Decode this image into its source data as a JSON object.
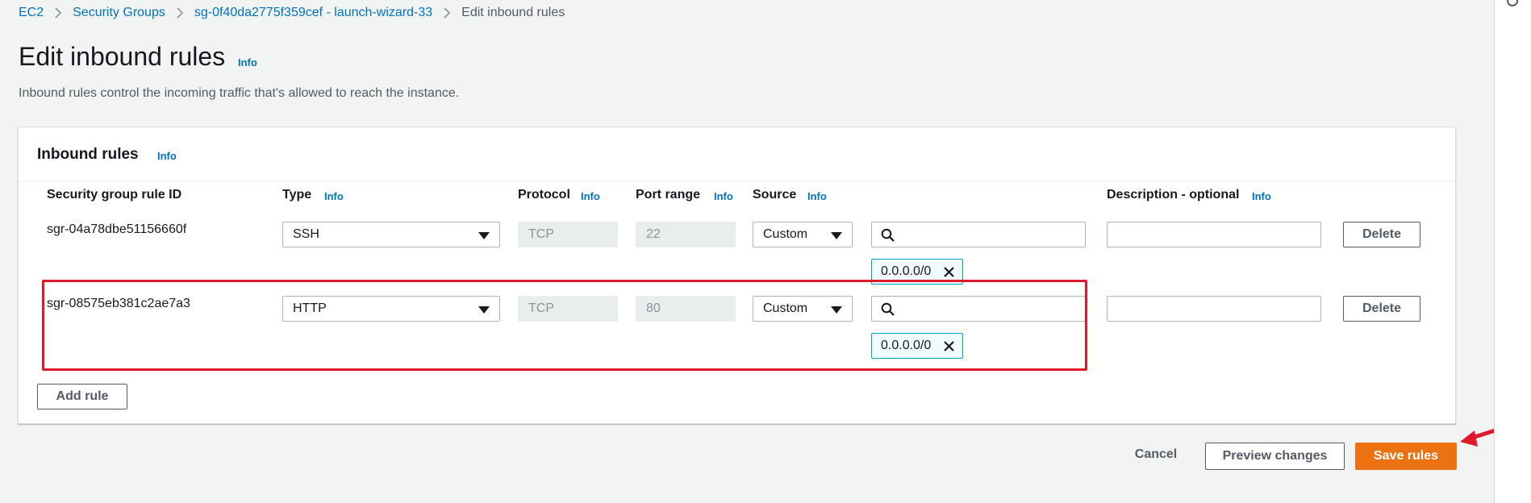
{
  "breadcrumb": {
    "items": [
      "EC2",
      "Security Groups",
      "sg-0f40da2775f359cef - launch-wizard-33"
    ],
    "current": "Edit inbound rules"
  },
  "page": {
    "title": "Edit inbound rules",
    "info": "Info",
    "subtitle": "Inbound rules control the incoming traffic that's allowed to reach the instance."
  },
  "panel": {
    "title": "Inbound rules",
    "info": "Info",
    "columns": {
      "rule_id": "Security group rule ID",
      "type": "Type",
      "protocol": "Protocol",
      "port_range": "Port range",
      "source": "Source",
      "description": "Description - optional"
    },
    "info_label": "Info",
    "rules": [
      {
        "rule_id": "sgr-04a78dbe51156660f",
        "type": "SSH",
        "protocol": "TCP",
        "port_range": "22",
        "source": "Custom",
        "search_value": "",
        "cidr": "0.0.0.0/0",
        "description": "",
        "delete_label": "Delete"
      },
      {
        "rule_id": "sgr-08575eb381c2ae7a3",
        "type": "HTTP",
        "protocol": "TCP",
        "port_range": "80",
        "source": "Custom",
        "search_value": "",
        "cidr": "0.0.0.0/0",
        "description": "",
        "delete_label": "Delete"
      }
    ],
    "add_rule_label": "Add rule"
  },
  "footer": {
    "cancel_label": "Cancel",
    "preview_label": "Preview changes",
    "save_label": "Save rules"
  },
  "colors": {
    "link": "#0073bb",
    "primary": "#ec7211",
    "highlight": "#e0182c",
    "token_border": "#00a1c9"
  },
  "icons": {
    "separator": "chevron-right-icon",
    "select": "caret-down-icon",
    "search": "search-icon",
    "token_remove": "close-icon",
    "annotation": "red-arrow-icon"
  }
}
